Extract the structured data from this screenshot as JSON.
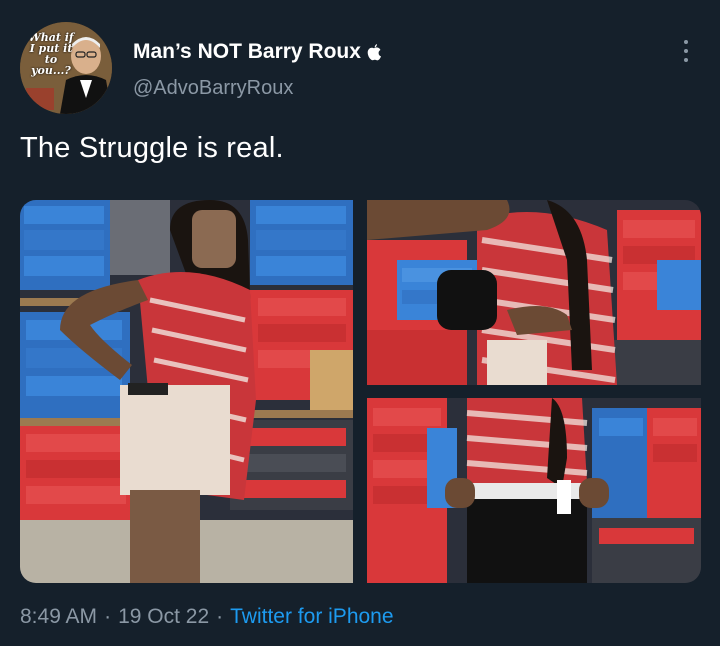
{
  "tweet": {
    "avatar_caption": "What if I put it to you...?",
    "display_name": "Man’s NOT Barry Roux",
    "badge_icon": "apple-icon",
    "handle": "@AdvoBarryRoux",
    "text": "The Struggle is real.",
    "time": "8:49 AM",
    "separator": "·",
    "date": "19 Oct 22",
    "source": "Twitter for iPhone"
  },
  "colors": {
    "background": "#15202b",
    "primary_text": "#ffffff",
    "secondary_text": "#8b98a5",
    "link": "#1d9bf0"
  },
  "media": {
    "count": 3,
    "photos": [
      "photo-1",
      "photo-2",
      "photo-3"
    ]
  }
}
